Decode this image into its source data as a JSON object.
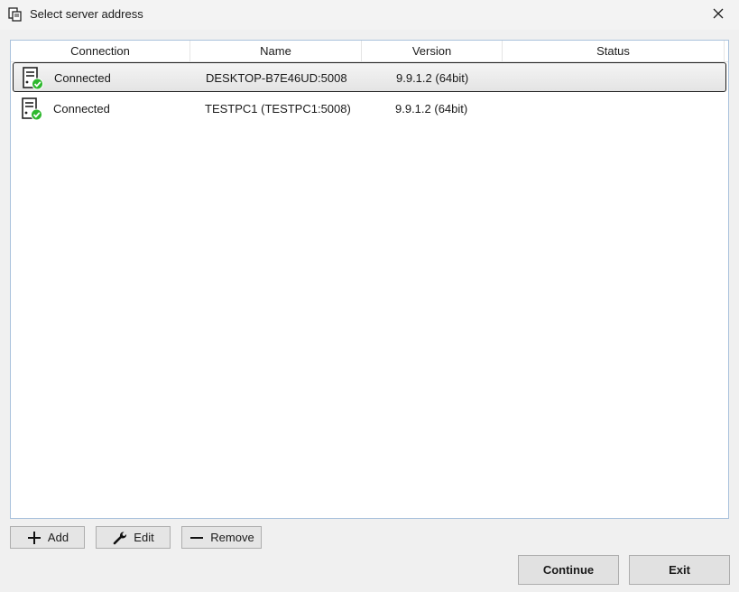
{
  "window": {
    "title": "Select server address"
  },
  "columns": [
    "Connection",
    "Name",
    "Version",
    "Status"
  ],
  "rows": [
    {
      "connection": "Connected",
      "name": "DESKTOP-B7E46UD:5008",
      "version": "9.9.1.2 (64bit)",
      "status": "",
      "selected": true
    },
    {
      "connection": "Connected",
      "name": "TESTPC1 (TESTPC1:5008)",
      "version": "9.9.1.2 (64bit)",
      "status": "",
      "selected": false
    }
  ],
  "buttons": {
    "add": "Add",
    "edit": "Edit",
    "remove": "Remove",
    "continue": "Continue",
    "exit": "Exit"
  },
  "icons": {
    "app": "server-window-icon",
    "row_status": "server-connected-icon",
    "close": "close-icon",
    "add": "plus-icon",
    "edit": "wrench-icon",
    "remove": "minus-icon"
  },
  "colors": {
    "connected_check": "#2eb82e",
    "list_border": "#a9c2dc"
  }
}
